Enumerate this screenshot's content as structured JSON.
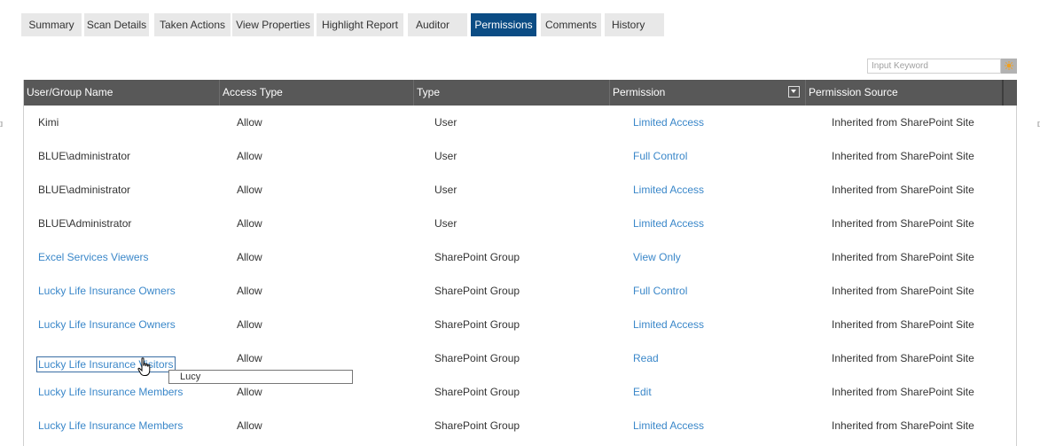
{
  "tabs": [
    "Summary",
    "Scan Details",
    "Taken Actions",
    "View Properties",
    "Highlight Report",
    "Auditor",
    "Permissions",
    "Comments",
    "History"
  ],
  "active_tab": "Permissions",
  "search": {
    "placeholder": "Input Keyword",
    "button_icon": "sun-icon"
  },
  "table": {
    "columns": [
      "User/Group Name",
      "Access Type",
      "Type",
      "Permission",
      "Permission Source"
    ],
    "rows": [
      {
        "name": "Kimi",
        "access": "Allow",
        "type": "User",
        "permission": "Limited Access",
        "source": "Inherited from SharePoint Site"
      },
      {
        "name": "BLUE\\administrator",
        "access": "Allow",
        "type": "User",
        "permission": "Full Control",
        "source": "Inherited from SharePoint Site"
      },
      {
        "name": "BLUE\\administrator",
        "access": "Allow",
        "type": "User",
        "permission": "Limited Access",
        "source": "Inherited from SharePoint Site"
      },
      {
        "name": "BLUE\\Administrator",
        "access": "Allow",
        "type": "User",
        "permission": "Limited Access",
        "source": "Inherited from SharePoint Site"
      },
      {
        "name": "Excel Services Viewers",
        "access": "Allow",
        "type": "SharePoint Group",
        "permission": "View Only",
        "source": "Inherited from SharePoint Site"
      },
      {
        "name": "Lucky Life Insurance Owners",
        "access": "Allow",
        "type": "SharePoint Group",
        "permission": "Full Control",
        "source": "Inherited from SharePoint Site"
      },
      {
        "name": "Lucky Life Insurance Owners",
        "access": "Allow",
        "type": "SharePoint Group",
        "permission": "Limited Access",
        "source": "Inherited from SharePoint Site"
      },
      {
        "name": "Lucky Life Insurance Visitors",
        "access": "Allow",
        "type": "SharePoint Group",
        "permission": "Read",
        "source": "Inherited from SharePoint Site"
      },
      {
        "name": "Lucky Life Insurance Members",
        "access": "Allow",
        "type": "SharePoint Group",
        "permission": "Edit",
        "source": "Inherited from SharePoint Site"
      },
      {
        "name": "Lucky Life Insurance Members",
        "access": "Allow",
        "type": "SharePoint Group",
        "permission": "Limited Access",
        "source": "Inherited from SharePoint Site"
      }
    ]
  },
  "tooltip": {
    "text": "Lucy"
  },
  "colors": {
    "active_tab": "#0b4c84",
    "header_bg": "#585858",
    "link": "#3a87c9"
  }
}
